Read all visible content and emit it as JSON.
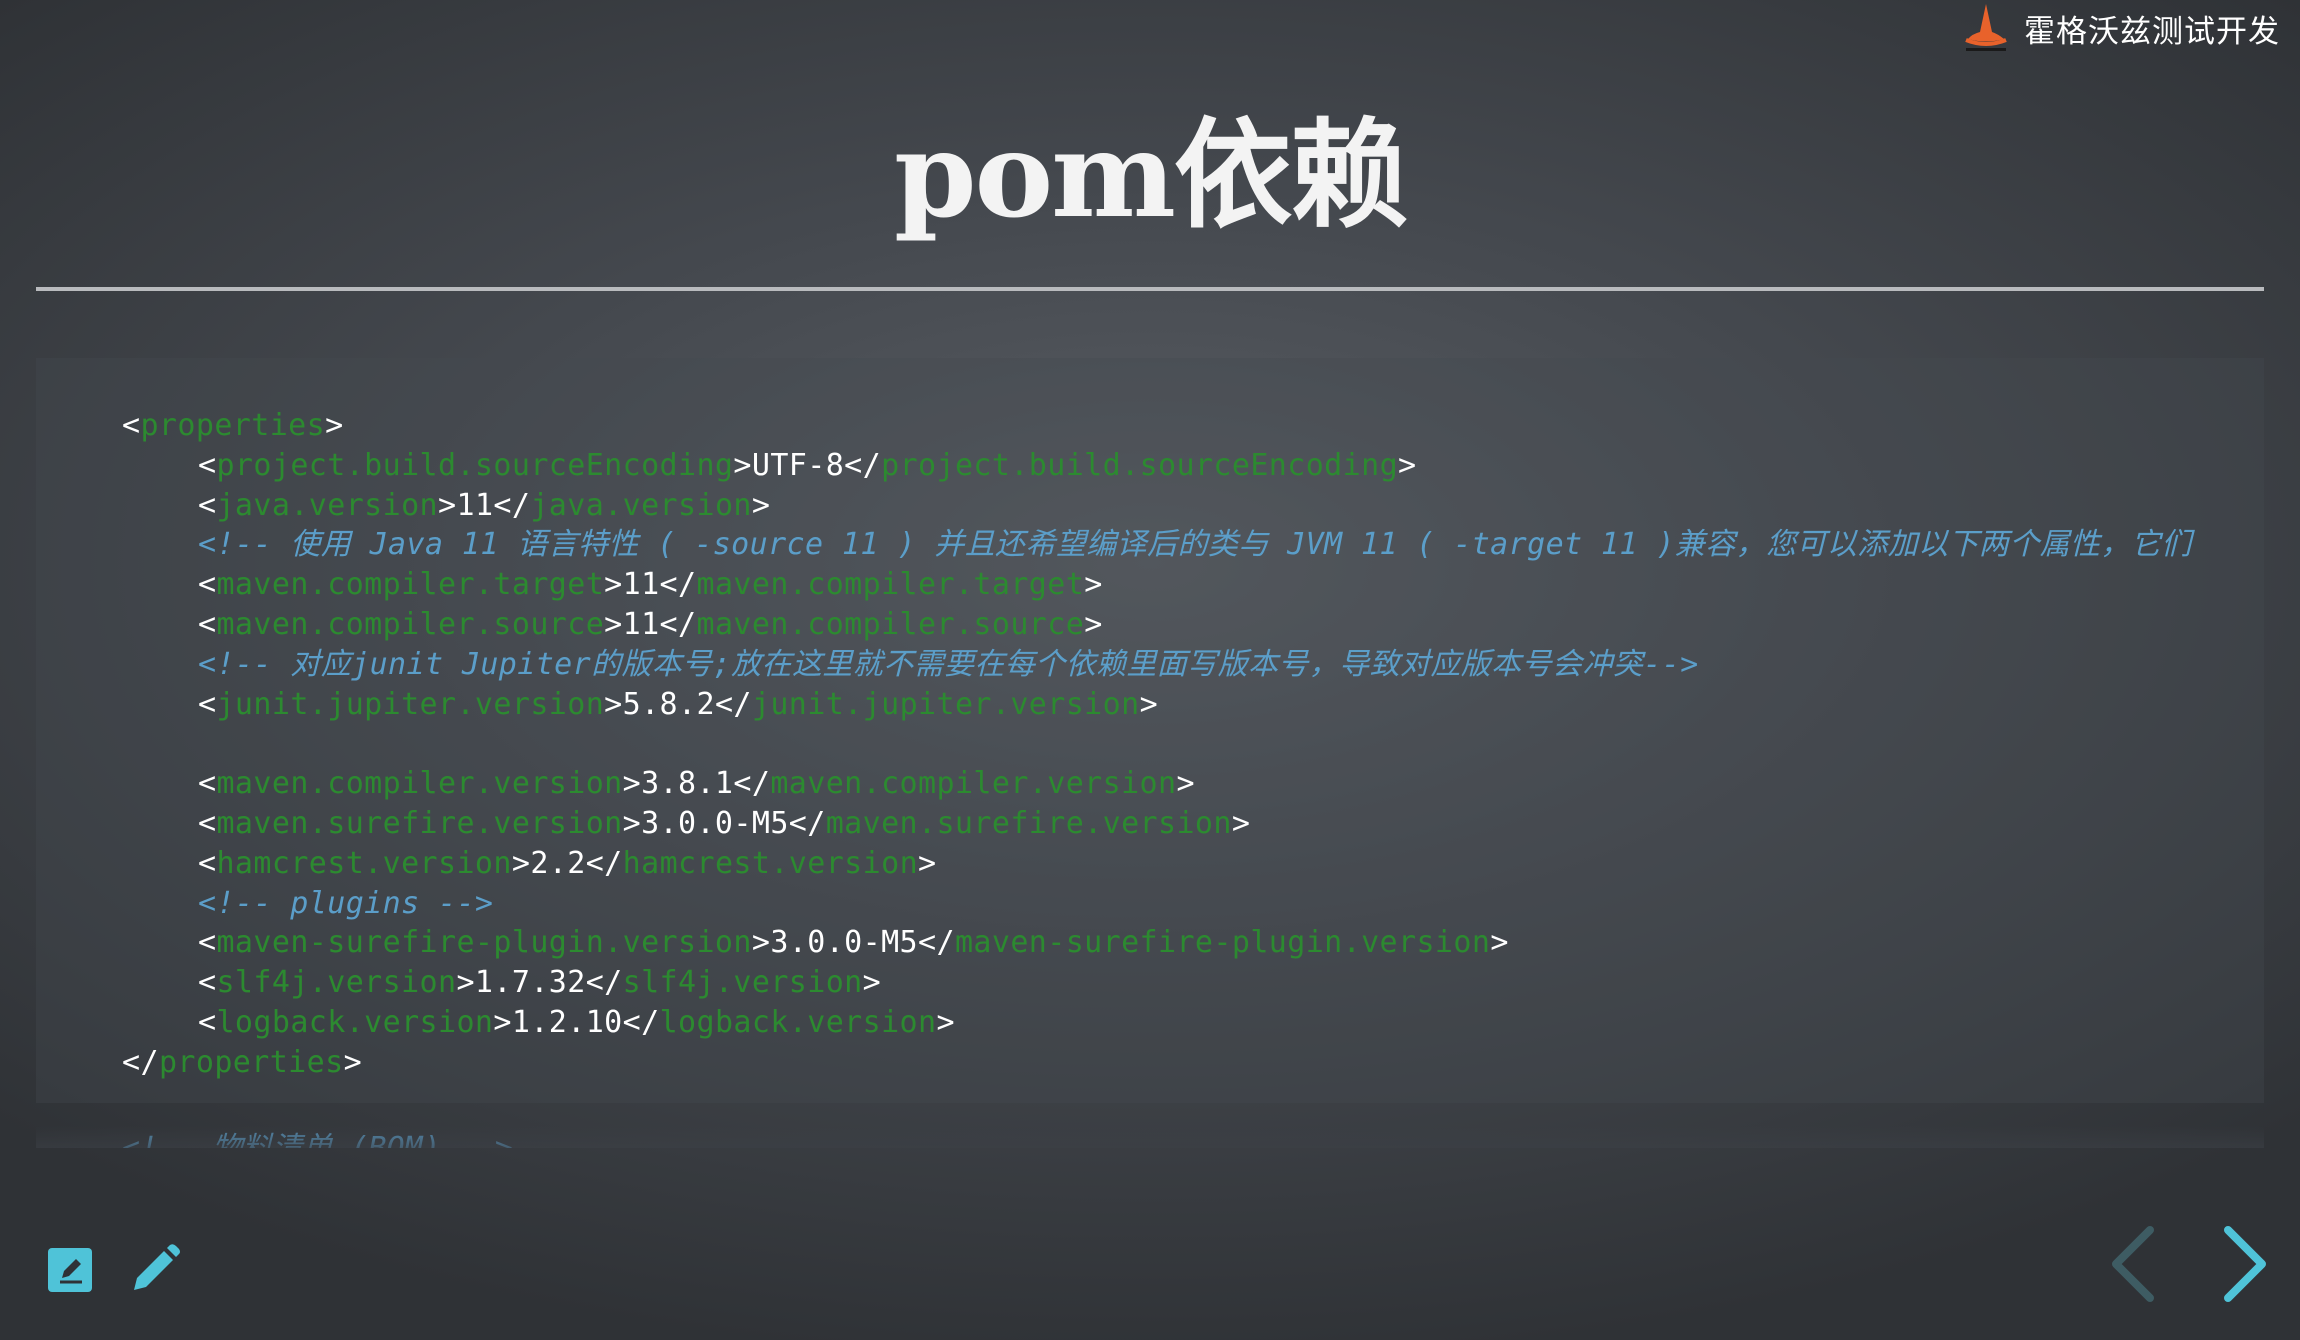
{
  "brand": {
    "name": "霍格沃兹测试开发",
    "logo_icon": "wizard-hat-icon"
  },
  "slide": {
    "title": "pom依赖"
  },
  "code": {
    "lines": [
      {
        "indent": 0,
        "tokens": [
          {
            "t": "<",
            "k": "punct"
          },
          {
            "t": "properties",
            "k": "tag"
          },
          {
            "t": ">",
            "k": "punct"
          }
        ]
      },
      {
        "indent": 1,
        "tokens": [
          {
            "t": "<",
            "k": "punct"
          },
          {
            "t": "project.build.sourceEncoding",
            "k": "tag"
          },
          {
            "t": ">UTF-8</",
            "k": "val"
          },
          {
            "t": "project.build.sourceEncoding",
            "k": "tag"
          },
          {
            "t": ">",
            "k": "punct"
          }
        ]
      },
      {
        "indent": 1,
        "tokens": [
          {
            "t": "<",
            "k": "punct"
          },
          {
            "t": "java.version",
            "k": "tag"
          },
          {
            "t": ">11</",
            "k": "val"
          },
          {
            "t": "java.version",
            "k": "tag"
          },
          {
            "t": ">",
            "k": "punct"
          }
        ]
      },
      {
        "indent": 1,
        "tokens": [
          {
            "t": "<!-- 使用 Java 11 语言特性 ( -source 11 ) 并且还希望编译后的类与 JVM 11 ( -target 11 )兼容，您可以添加以下两个属性，它们",
            "k": "comment"
          }
        ]
      },
      {
        "indent": 1,
        "tokens": [
          {
            "t": "<",
            "k": "punct"
          },
          {
            "t": "maven.compiler.target",
            "k": "tag"
          },
          {
            "t": ">11</",
            "k": "val"
          },
          {
            "t": "maven.compiler.target",
            "k": "tag"
          },
          {
            "t": ">",
            "k": "punct"
          }
        ]
      },
      {
        "indent": 1,
        "tokens": [
          {
            "t": "<",
            "k": "punct"
          },
          {
            "t": "maven.compiler.source",
            "k": "tag"
          },
          {
            "t": ">11</",
            "k": "val"
          },
          {
            "t": "maven.compiler.source",
            "k": "tag"
          },
          {
            "t": ">",
            "k": "punct"
          }
        ]
      },
      {
        "indent": 1,
        "tokens": [
          {
            "t": "<!-- 对应junit Jupiter的版本号;放在这里就不需要在每个依赖里面写版本号，导致对应版本号会冲突-->",
            "k": "comment"
          }
        ]
      },
      {
        "indent": 1,
        "tokens": [
          {
            "t": "<",
            "k": "punct"
          },
          {
            "t": "junit.jupiter.version",
            "k": "tag"
          },
          {
            "t": ">5.8.2</",
            "k": "val"
          },
          {
            "t": "junit.jupiter.version",
            "k": "tag"
          },
          {
            "t": ">",
            "k": "punct"
          }
        ]
      },
      {
        "indent": 1,
        "tokens": []
      },
      {
        "indent": 1,
        "tokens": [
          {
            "t": "<",
            "k": "punct"
          },
          {
            "t": "maven.compiler.version",
            "k": "tag"
          },
          {
            "t": ">3.8.1</",
            "k": "val"
          },
          {
            "t": "maven.compiler.version",
            "k": "tag"
          },
          {
            "t": ">",
            "k": "punct"
          }
        ]
      },
      {
        "indent": 1,
        "tokens": [
          {
            "t": "<",
            "k": "punct"
          },
          {
            "t": "maven.surefire.version",
            "k": "tag"
          },
          {
            "t": ">3.0.0-M5</",
            "k": "val"
          },
          {
            "t": "maven.surefire.version",
            "k": "tag"
          },
          {
            "t": ">",
            "k": "punct"
          }
        ]
      },
      {
        "indent": 1,
        "tokens": [
          {
            "t": "<",
            "k": "punct"
          },
          {
            "t": "hamcrest.version",
            "k": "tag"
          },
          {
            "t": ">2.2</",
            "k": "val"
          },
          {
            "t": "hamcrest.version",
            "k": "tag"
          },
          {
            "t": ">",
            "k": "punct"
          }
        ]
      },
      {
        "indent": 1,
        "tokens": [
          {
            "t": "<!-- plugins -->",
            "k": "comment"
          }
        ]
      },
      {
        "indent": 1,
        "tokens": [
          {
            "t": "<",
            "k": "punct"
          },
          {
            "t": "maven-surefire-plugin.version",
            "k": "tag"
          },
          {
            "t": ">3.0.0-M5</",
            "k": "val"
          },
          {
            "t": "maven-surefire-plugin.version",
            "k": "tag"
          },
          {
            "t": ">",
            "k": "punct"
          }
        ]
      },
      {
        "indent": 1,
        "tokens": [
          {
            "t": "<",
            "k": "punct"
          },
          {
            "t": "slf4j.version",
            "k": "tag"
          },
          {
            "t": ">1.7.32</",
            "k": "val"
          },
          {
            "t": "slf4j.version",
            "k": "tag"
          },
          {
            "t": ">",
            "k": "punct"
          }
        ]
      },
      {
        "indent": 1,
        "tokens": [
          {
            "t": "<",
            "k": "punct"
          },
          {
            "t": "logback.version",
            "k": "tag"
          },
          {
            "t": ">1.2.10</",
            "k": "val"
          },
          {
            "t": "logback.version",
            "k": "tag"
          },
          {
            "t": ">",
            "k": "punct"
          }
        ]
      },
      {
        "indent": 0,
        "tokens": [
          {
            "t": "</",
            "k": "punct"
          },
          {
            "t": "properties",
            "k": "tag"
          },
          {
            "t": ">",
            "k": "punct"
          }
        ]
      }
    ],
    "next_line_peek": "<!-- 物料清单 (BOM) -->"
  },
  "toolbar": {
    "edit_note_icon": "edit-note-icon",
    "pencil_icon": "pencil-icon"
  },
  "navigation": {
    "prev_icon": "chevron-left-icon",
    "next_icon": "chevron-right-icon"
  },
  "colors": {
    "tag": "#2c8a30",
    "comment": "#5b9ec9",
    "accent": "#4fc3d8",
    "nav_disabled": "#3e5c63",
    "brand_orange": "#e8622b"
  }
}
